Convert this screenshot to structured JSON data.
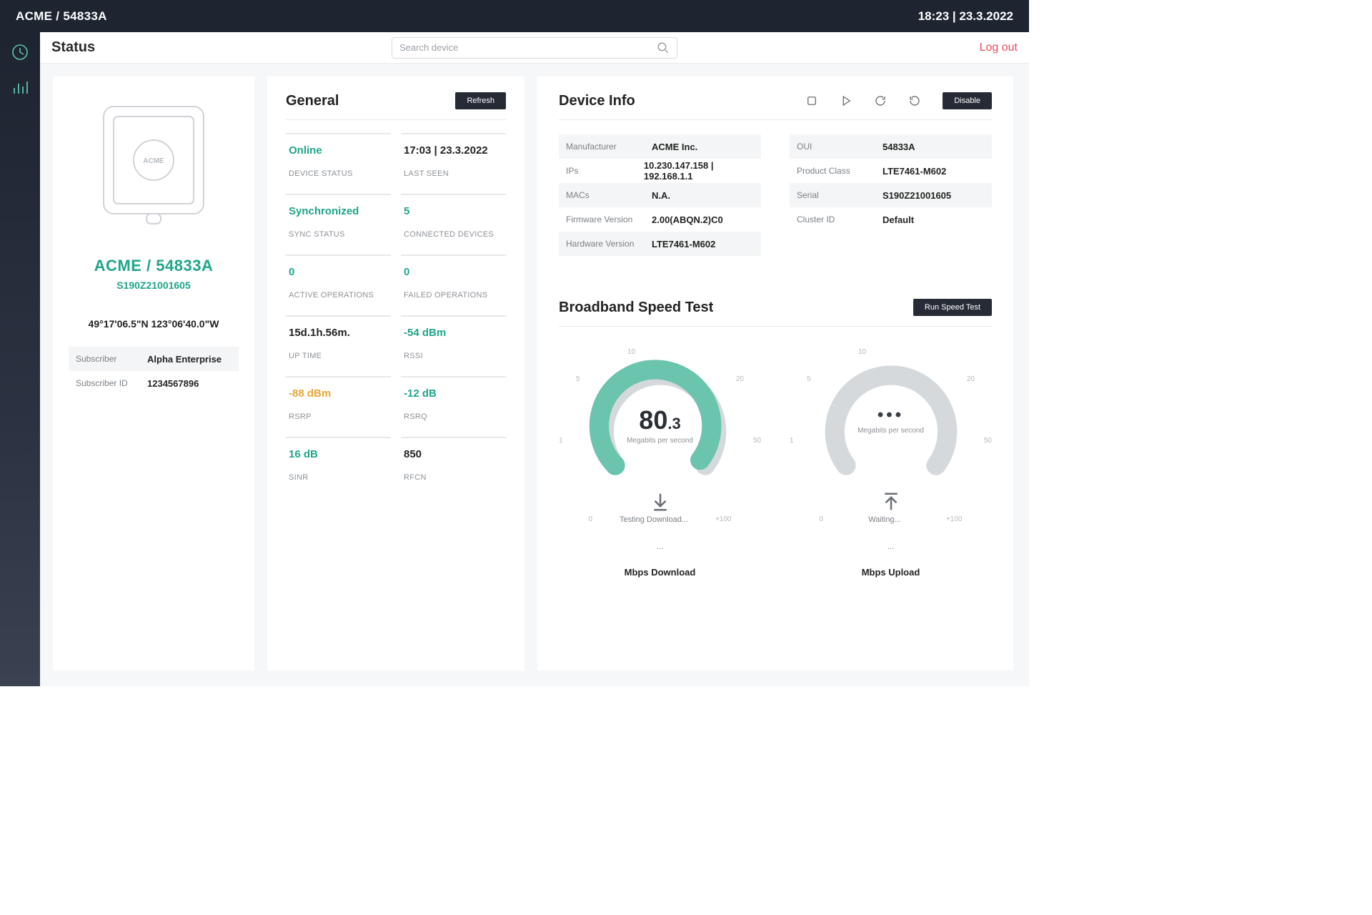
{
  "top": {
    "breadcrumb": "ACME / 54833A",
    "clock": "18:23 | 23.3.2022"
  },
  "header": {
    "title": "Status",
    "search_placeholder": "Search device",
    "logout": "Log out"
  },
  "device_card": {
    "logo_label": "ACME",
    "name": "ACME / 54833A",
    "serial": "S190Z21001605",
    "location": "49°17'06.5\"N 123°06'40.0\"W",
    "subscriber_label": "Subscriber",
    "subscriber": "Alpha Enterprise",
    "subscriber_id_label": "Subscriber ID",
    "subscriber_id": "1234567896"
  },
  "general": {
    "title": "General",
    "refresh": "Refresh",
    "tiles": [
      {
        "value": "Online",
        "label": "DEVICE STATUS",
        "color": "green"
      },
      {
        "value": "17:03 | 23.3.2022",
        "label": "LAST SEEN",
        "color": "black"
      },
      {
        "value": "Synchronized",
        "label": "SYNC STATUS",
        "color": "green"
      },
      {
        "value": "5",
        "label": "CONNECTED DEVICES",
        "color": "green"
      },
      {
        "value": "0",
        "label": "ACTIVE OPERATIONS",
        "color": "green"
      },
      {
        "value": "0",
        "label": "FAILED OPERATIONS",
        "color": "green"
      },
      {
        "value": "15d.1h.56m.",
        "label": "UP TIME",
        "color": "black"
      },
      {
        "value": "-54 dBm",
        "label": "RSSI",
        "color": "green"
      },
      {
        "value": "-88 dBm",
        "label": "RSRP",
        "color": "amber"
      },
      {
        "value": "-12 dB",
        "label": "RSRQ",
        "color": "green"
      },
      {
        "value": "16 dB",
        "label": "SINR",
        "color": "green"
      },
      {
        "value": "850",
        "label": "RFCN",
        "color": "black"
      }
    ]
  },
  "device_info": {
    "title": "Device Info",
    "disable": "Disable",
    "left": [
      {
        "label": "Manufacturer",
        "value": "ACME Inc."
      },
      {
        "label": "IPs",
        "value": "10.230.147.158 | 192.168.1.1"
      },
      {
        "label": "MACs",
        "value": "N.A."
      },
      {
        "label": "Firmware Version",
        "value": "2.00(ABQN.2)C0"
      },
      {
        "label": "Hardware Version",
        "value": "LTE7461-M602"
      }
    ],
    "right": [
      {
        "label": "OUI",
        "value": "54833A"
      },
      {
        "label": "Product Class",
        "value": "LTE7461-M602"
      },
      {
        "label": "Serial",
        "value": "S190Z21001605"
      },
      {
        "label": "Cluster ID",
        "value": "Default"
      }
    ]
  },
  "speed": {
    "title": "Broadband Speed Test",
    "run": "Run Speed Test",
    "unit": "Megabits per second",
    "ticks": {
      "t0": "0",
      "t1": "1",
      "t5": "5",
      "t10": "10",
      "t20": "20",
      "t50": "50",
      "t100": "+100"
    },
    "download": {
      "value_int": "80",
      "value_frac": ".3",
      "state": "Testing Download...",
      "timestamp": "...",
      "label": "Mbps Download"
    },
    "upload": {
      "dots": "•••",
      "state": "Waiting...",
      "timestamp": "...",
      "label": "Mbps Upload"
    }
  }
}
